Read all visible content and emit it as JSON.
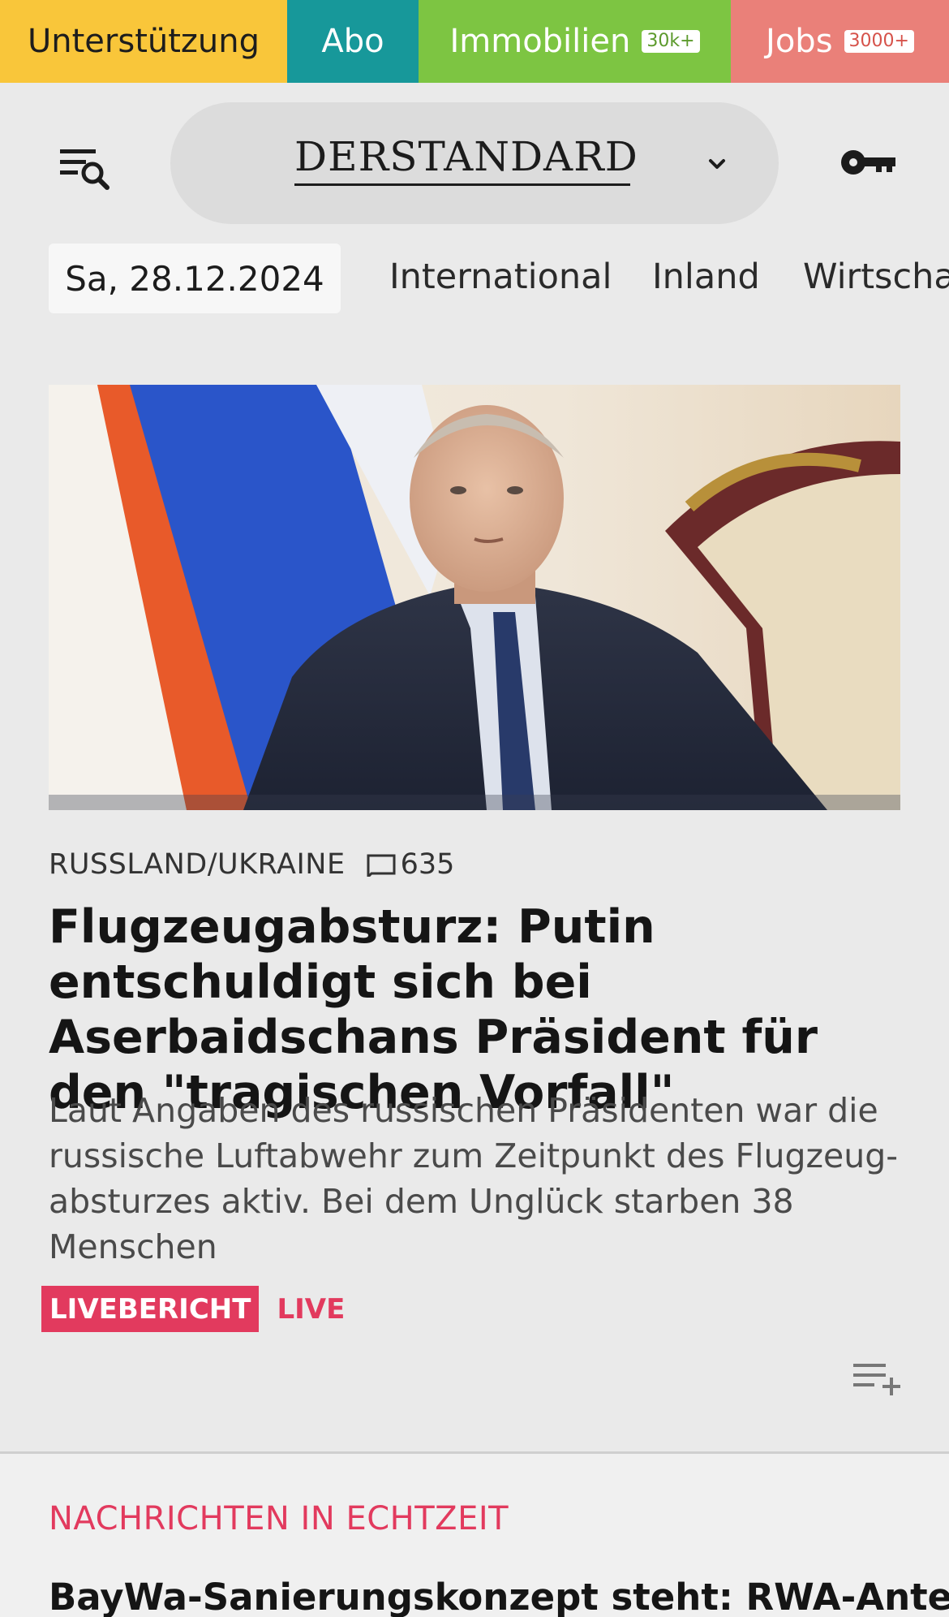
{
  "topbar": {
    "support": "Unterstützung",
    "abo": "Abo",
    "immobilien": "Immobilien",
    "immobilien_badge": "30k+",
    "jobs": "Jobs",
    "jobs_badge": "3000+"
  },
  "header": {
    "logo": "DERSTANDARD"
  },
  "nav": {
    "date": "Sa, 28.12.2024",
    "items": [
      "International",
      "Inland",
      "Wirtscha"
    ]
  },
  "article": {
    "kicker": "RUSSLAND/UKRAINE",
    "comments": "635",
    "headline": "Flugzeugabsturz: Putin entschuldigt sich bei Aserbaidschans Präsident für den \"tragischen Vorfall\"",
    "teaser": "Laut Angaben des russischen Präsidenten war die russische Luftabwehr zum Zeitpunkt des Flugzeug-absturzes aktiv. Bei dem Unglück starben 38 Menschen",
    "live_badge": "LIVEBERICHT",
    "live_text": "LIVE"
  },
  "section": {
    "title": "NACHRICHTEN IN ECHTZEIT",
    "first_headline": "BayWa-Sanierungskonzept steht: RWA-Anteil"
  },
  "colors": {
    "support": "#f9c63a",
    "abo": "#17989a",
    "immobilien": "#7dc542",
    "jobs": "#ea8079",
    "accent_live": "#e23a5e"
  }
}
